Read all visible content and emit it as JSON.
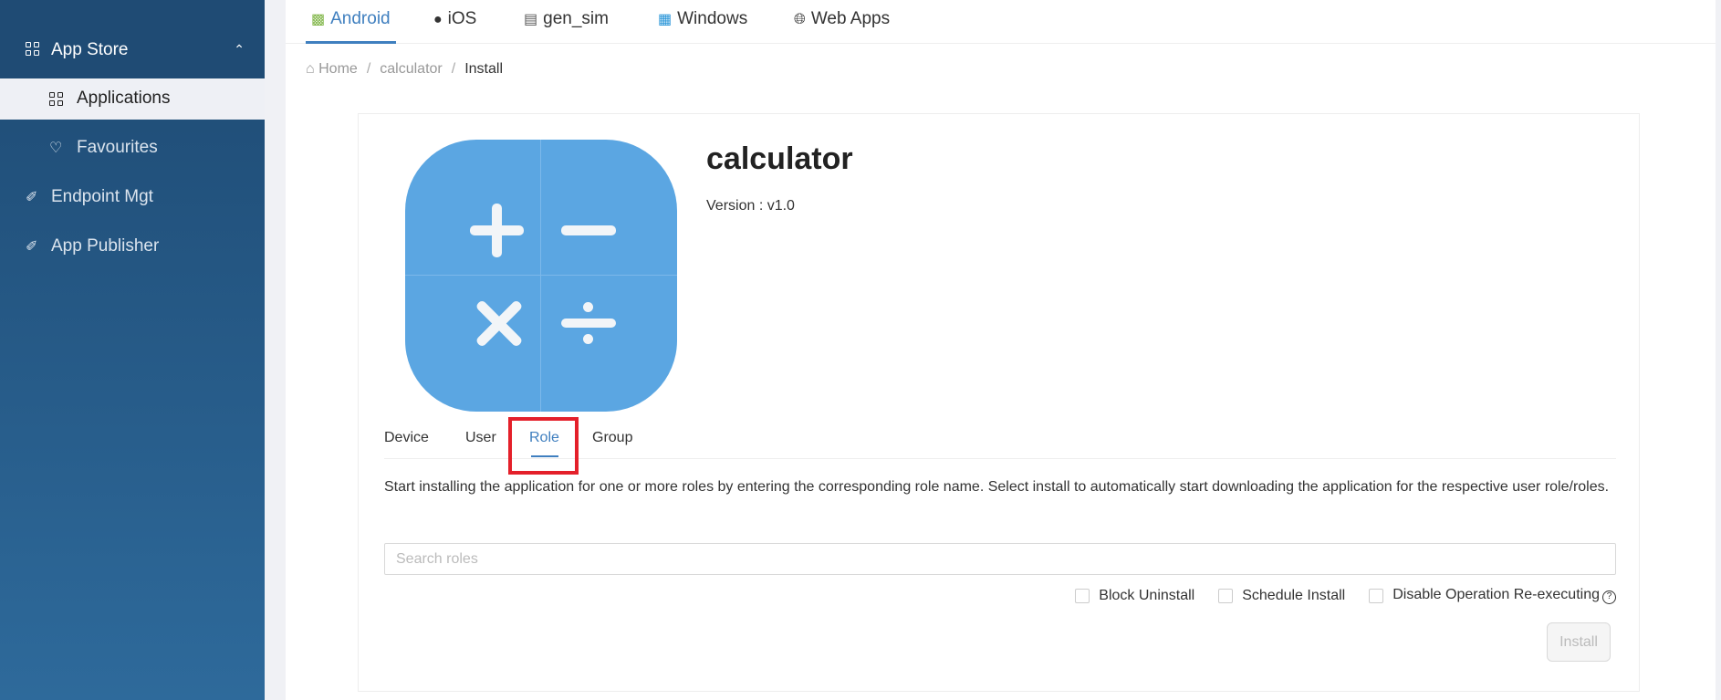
{
  "sidebar": {
    "header": {
      "label": "App Store",
      "icon": "grid-icon"
    },
    "items": [
      {
        "label": "Applications",
        "icon": "grid-icon",
        "active": true
      },
      {
        "label": "Favourites",
        "icon": "heart-icon"
      },
      {
        "label": "Endpoint Mgt",
        "icon": "plug-icon"
      },
      {
        "label": "App Publisher",
        "icon": "plug-icon"
      }
    ]
  },
  "platform_tabs": [
    {
      "label": "Android",
      "icon": "android-icon",
      "active": true
    },
    {
      "label": "iOS",
      "icon": "apple-icon"
    },
    {
      "label": "gen_sim",
      "icon": "server-icon"
    },
    {
      "label": "Windows",
      "icon": "windows-icon"
    },
    {
      "label": "Web Apps",
      "icon": "globe-icon"
    }
  ],
  "breadcrumb": {
    "home": "Home",
    "app": "calculator",
    "current": "Install",
    "sep": "/"
  },
  "app": {
    "name": "calculator",
    "version": "Version : v1.0"
  },
  "install_tabs": [
    {
      "label": "Device"
    },
    {
      "label": "User"
    },
    {
      "label": "Role",
      "active": true
    },
    {
      "label": "Group"
    }
  ],
  "description": "Start installing the application for one or more roles by entering the corresponding role name. Select install to automatically start downloading the application for the respective user role/roles.",
  "search": {
    "placeholder": "Search roles",
    "value": ""
  },
  "options": [
    {
      "label": "Block Uninstall",
      "checked": false
    },
    {
      "label": "Schedule Install",
      "checked": false
    },
    {
      "label": "Disable Operation Re-executing",
      "checked": false
    }
  ],
  "help_glyph": "?",
  "install_button": "Install",
  "colors": {
    "accent": "#3f7fbf",
    "sidebar": "#1f4b74",
    "highlight": "#e4202a",
    "app_icon": "#5ba6e2"
  }
}
